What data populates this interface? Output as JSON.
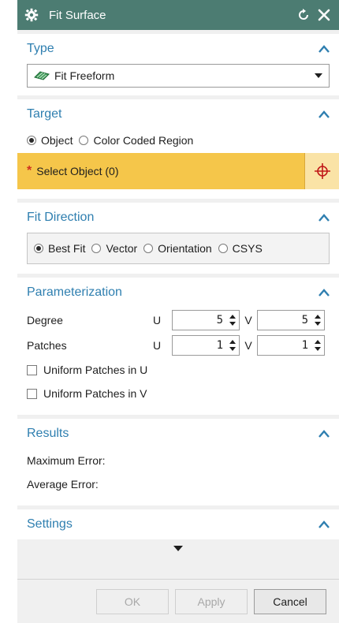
{
  "window": {
    "title": "Fit Surface"
  },
  "type": {
    "header": "Type",
    "selected": "Fit Freeform"
  },
  "target": {
    "header": "Target",
    "radio_object": "Object",
    "radio_color_region": "Color Coded Region",
    "selector_required": "*",
    "selector_label": "Select Object (0)"
  },
  "fit_direction": {
    "header": "Fit Direction",
    "options": [
      "Best Fit",
      "Vector",
      "Orientation",
      "CSYS"
    ]
  },
  "parameterization": {
    "header": "Parameterization",
    "degree_label": "Degree",
    "patches_label": "Patches",
    "u_label": "U",
    "v_label": "V",
    "degree_u": "5",
    "degree_v": "5",
    "patches_u": "1",
    "patches_v": "1",
    "uniform_u": "Uniform Patches in U",
    "uniform_v": "Uniform Patches in V"
  },
  "results": {
    "header": "Results",
    "max_error": "Maximum Error:",
    "avg_error": "Average Error:"
  },
  "settings": {
    "header": "Settings"
  },
  "buttons": {
    "ok": "OK",
    "apply": "Apply",
    "cancel": "Cancel"
  },
  "colors": {
    "titlebar": "#4c7c72",
    "section_header": "#2f7fb0",
    "selector_highlight": "#f5c64a",
    "required_star": "#d0301e",
    "crosshair": "#c01818"
  }
}
